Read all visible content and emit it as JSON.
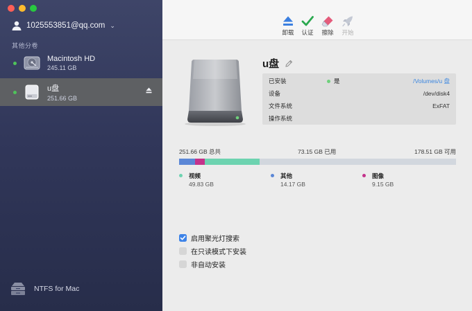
{
  "account": {
    "email": "1025553851@qq.com",
    "caret": "⌄"
  },
  "sidebar": {
    "section_label": "其他分卷",
    "volumes": [
      {
        "name": "Macintosh HD",
        "size": "245.11 GB",
        "mounted": true,
        "selected": false
      },
      {
        "name": "u盘",
        "size": "251.66 GB",
        "mounted": true,
        "selected": true
      }
    ],
    "brand": "NTFS for Mac"
  },
  "toolbar": {
    "unmount": "卸载",
    "verify": "认证",
    "erase": "擦除",
    "start": "开始"
  },
  "disk": {
    "name": "u盘",
    "info": [
      {
        "label": "已安装",
        "status": "是",
        "value": "/Volumes/u 盘"
      },
      {
        "label": "设备",
        "value": "/dev/disk4"
      },
      {
        "label": "文件系统",
        "value": "ExFAT"
      },
      {
        "label": "操作系统",
        "value": ""
      }
    ]
  },
  "capacity": {
    "total": "251.66 GB 总共",
    "used": "73.15 GB 已用",
    "free": "178.51 GB 可用"
  },
  "usage": [
    {
      "name": "视频",
      "size": "49.83 GB",
      "value_gb": 49.83,
      "color": "#6dd3b0"
    },
    {
      "name": "其他",
      "size": "14.17 GB",
      "value_gb": 14.17,
      "color": "#5b87d6"
    },
    {
      "name": "图像",
      "size": "9.15 GB",
      "value_gb": 9.15,
      "color": "#c4338b"
    }
  ],
  "options": [
    {
      "label": "启用聚光灯搜索",
      "checked": true
    },
    {
      "label": "在只读模式下安装",
      "checked": false
    },
    {
      "label": "非自动安装",
      "checked": false
    }
  ],
  "colors": {
    "accent": "#3d83e8",
    "mounted_dot": "#4fc35a",
    "link": "#3b86e0"
  }
}
